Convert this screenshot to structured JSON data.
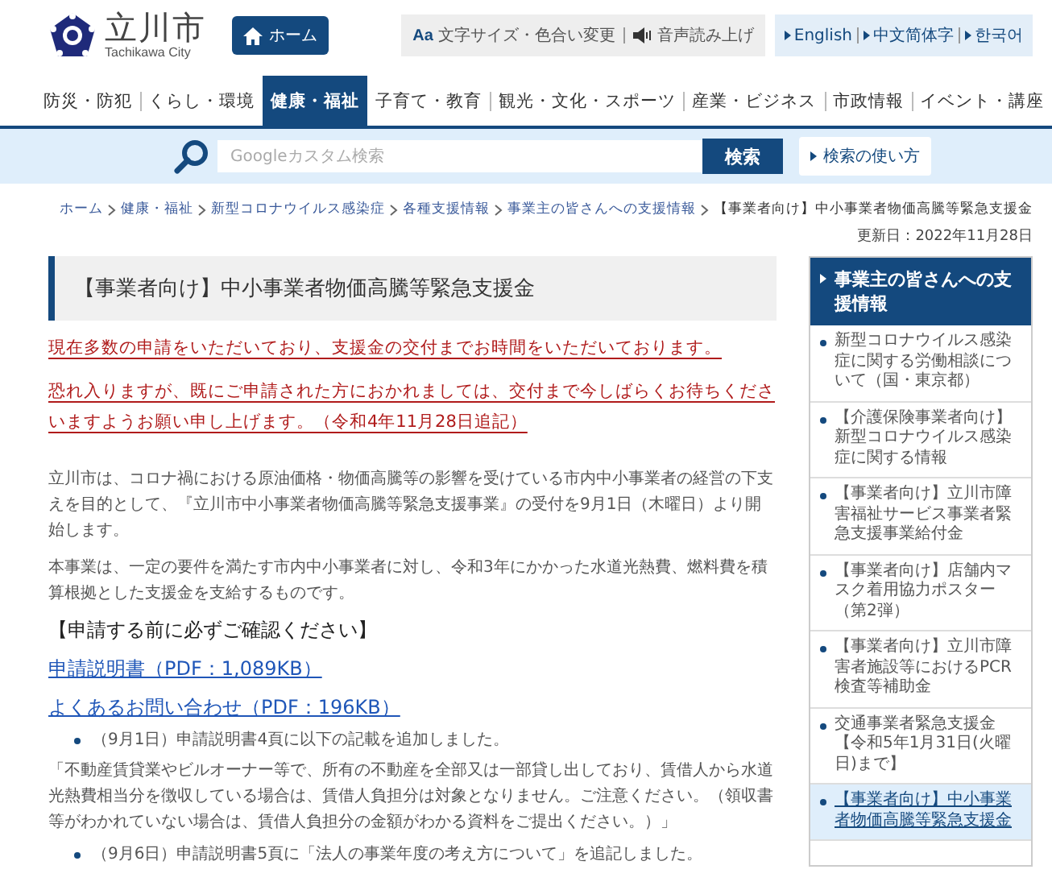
{
  "header": {
    "logo_text": "立川市",
    "logo_sub": "Tachikawa City",
    "home_button": "ホーム",
    "tools": [
      {
        "kind": "text-size",
        "icon_text": "Aa",
        "label": "文字サイズ・色合い変更"
      },
      {
        "kind": "speech",
        "label": "音声読み上げ"
      }
    ],
    "languages": [
      "English",
      "中文简体字",
      "한국어"
    ]
  },
  "nav": [
    {
      "label": "防災・防犯",
      "selected": false
    },
    {
      "label": "くらし・環境",
      "selected": false
    },
    {
      "label": "健康・福祉",
      "selected": true
    },
    {
      "label": "子育て・教育",
      "selected": false
    },
    {
      "label": "観光・文化・スポーツ",
      "selected": false
    },
    {
      "label": "産業・ビジネス",
      "selected": false
    },
    {
      "label": "市政情報",
      "selected": false
    },
    {
      "label": "イベント・講座",
      "selected": false
    }
  ],
  "search": {
    "placeholder": "Googleカスタム検索",
    "button": "検索",
    "help": "検索の使い方"
  },
  "breadcrumb": [
    "ホーム",
    "健康・福祉",
    "新型コロナウイルス感染症",
    "各種支援情報",
    "事業主の皆さんへの支援情報",
    "【事業者向け】中小事業者物価高騰等緊急支援金"
  ],
  "updated": "更新日：2022年11月28日",
  "title": "【事業者向け】中小事業者物価高騰等緊急支援金",
  "content": [
    {
      "kind": "notice",
      "text": "現在多数の申請をいただいており、支援金の交付までお時間をいただいております。"
    },
    {
      "kind": "notice",
      "text": "恐れ入りますが、既にご申請された方におかれましては、交付まで今しばらくお待ちくださいますようお願い申し上げます。（令和4年11月28日追記）"
    },
    {
      "kind": "paragraph",
      "text": "立川市は、コロナ禍における原油価格・物価高騰等の影響を受けている市内中小事業者の経営の下支えを目的として、『立川市中小事業者物価高騰等緊急支援事業』の受付を9月1日（木曜日）より開始します。"
    },
    {
      "kind": "paragraph",
      "text": "本事業は、一定の要件を満たす市内中小事業者に対し、令和3年にかかった水道光熱費、燃料費を積算根拠とした支援金を支給するものです。"
    },
    {
      "kind": "heading",
      "text": "【申請する前に必ずご確認ください】"
    },
    {
      "kind": "link",
      "text": "申請説明書（PDF：1,089KB）"
    },
    {
      "kind": "link",
      "text": "よくあるお問い合わせ（PDF：196KB）"
    },
    {
      "kind": "bullet",
      "text": "（9月1日）申請説明書4頁に以下の記載を追加しました。"
    },
    {
      "kind": "quote",
      "text": "「不動産賃貸業やビルオーナー等で、所有の不動産を全部又は一部貸し出しており、賃借人から水道光熱費相当分を徴収している場合は、賃借人負担分は対象となりません。ご注意ください。（領収書等がわかれていない場合は、賃借人負担分の金額がわかる資料をご提出ください。）」"
    },
    {
      "kind": "bullet",
      "text": "（9月6日）申請説明書5頁に「法人の事業年度の考え方について」を追記しました。"
    }
  ],
  "sidebar": {
    "heading": "事業主の皆さんへの支援情報",
    "items": [
      {
        "label": "新型コロナウイルス感染症に関する労働相談について（国・東京都）",
        "selected": false
      },
      {
        "label": "【介護保険事業者向け】新型コロナウイルス感染症に関する情報",
        "selected": false
      },
      {
        "label": "【事業者向け】立川市障害福祉サービス事業者緊急支援事業給付金",
        "selected": false
      },
      {
        "label": "【事業者向け】店舗内マスク着用協力ポスター（第2弾）",
        "selected": false
      },
      {
        "label": "【事業者向け】立川市障害者施設等におけるPCR検査等補助金",
        "selected": false
      },
      {
        "label": "交通事業者緊急支援金【令和5年1月31日(火曜日)まで】",
        "selected": false
      },
      {
        "label": "【事業者向け】中小事業者物価高騰等緊急支援金",
        "selected": true
      }
    ]
  }
}
